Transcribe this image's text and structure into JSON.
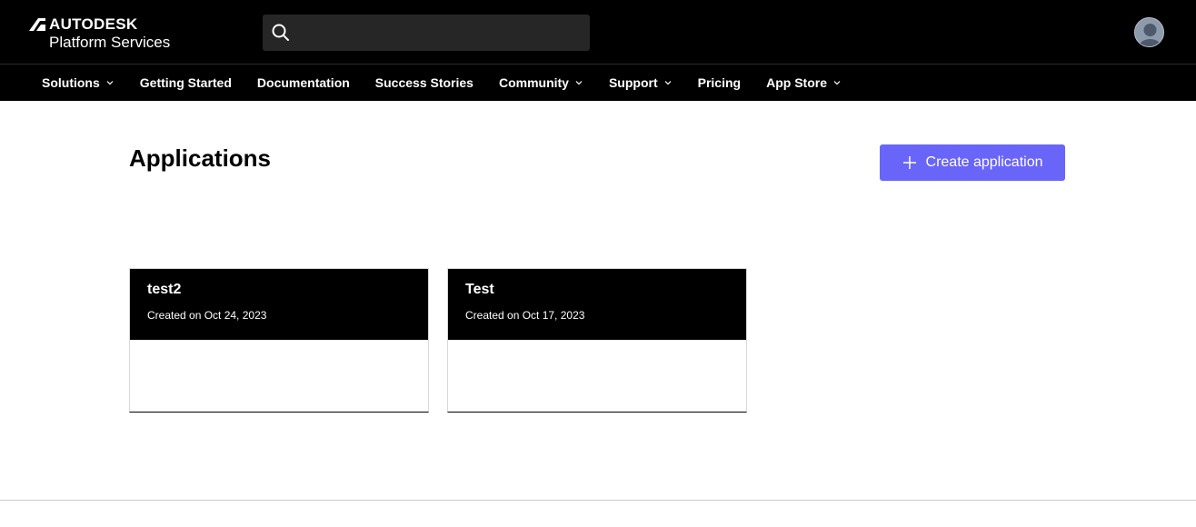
{
  "header": {
    "brand": "AUTODESK",
    "product": "Platform Services",
    "search": {
      "value": "",
      "placeholder": ""
    }
  },
  "nav": {
    "items": [
      {
        "label": "Solutions",
        "has_dropdown": true
      },
      {
        "label": "Getting Started",
        "has_dropdown": false
      },
      {
        "label": "Documentation",
        "has_dropdown": false
      },
      {
        "label": "Success Stories",
        "has_dropdown": false
      },
      {
        "label": "Community",
        "has_dropdown": true
      },
      {
        "label": "Support",
        "has_dropdown": true
      },
      {
        "label": "Pricing",
        "has_dropdown": false
      },
      {
        "label": "App Store",
        "has_dropdown": true
      }
    ]
  },
  "main": {
    "title": "Applications",
    "create_label": "Create application",
    "applications": [
      {
        "name": "test2",
        "created": "Created on Oct 24, 2023"
      },
      {
        "name": "Test",
        "created": "Created on Oct 17, 2023"
      }
    ]
  },
  "colors": {
    "header_bg": "#000000",
    "accent": "#6965f9",
    "card_header_bg": "#000000"
  },
  "icons": {
    "search": "search-icon",
    "avatar": "user-avatar",
    "dropdown": "chevron-down-icon",
    "create": "plus-icon"
  }
}
